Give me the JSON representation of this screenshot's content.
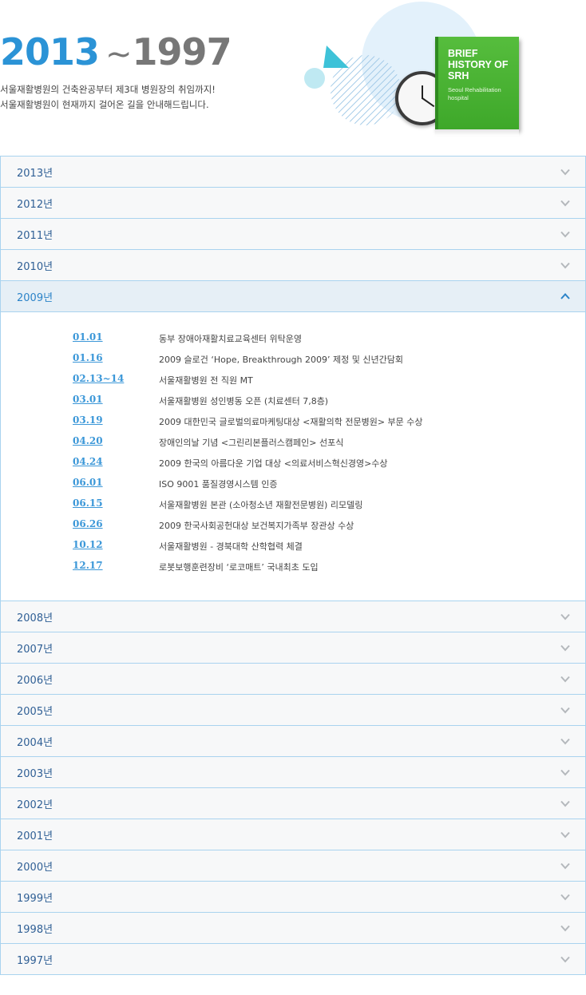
{
  "header": {
    "year_start": "2013",
    "tilde": "~",
    "year_end": "1997",
    "desc_line1": "서울재활병원의 건축완공부터 제3대 병원장의 취임까지!",
    "desc_line2": "서울재활병원이 현재까지 걸어온 길을 안내해드립니다."
  },
  "book": {
    "title": "BRIEF\nHISTORY OF\nSRH",
    "subtitle": "Seoul Rehabilitation\nhospital"
  },
  "years": [
    {
      "label": "2013년",
      "open": false
    },
    {
      "label": "2012년",
      "open": false
    },
    {
      "label": "2011년",
      "open": false
    },
    {
      "label": "2010년",
      "open": false
    },
    {
      "label": "2009년",
      "open": true
    },
    {
      "label": "2008년",
      "open": false
    },
    {
      "label": "2007년",
      "open": false
    },
    {
      "label": "2006년",
      "open": false
    },
    {
      "label": "2005년",
      "open": false
    },
    {
      "label": "2004년",
      "open": false
    },
    {
      "label": "2003년",
      "open": false
    },
    {
      "label": "2002년",
      "open": false
    },
    {
      "label": "2001년",
      "open": false
    },
    {
      "label": "2000년",
      "open": false
    },
    {
      "label": "1999년",
      "open": false
    },
    {
      "label": "1998년",
      "open": false
    },
    {
      "label": "1997년",
      "open": false
    }
  ],
  "events_2009": [
    {
      "date": "01.01",
      "text": "동부 장애아재활치료교육센터 위탁운영"
    },
    {
      "date": "01.16",
      "text": "2009 슬로건 ‘Hope, Breakthrough 2009’ 제정 및 신년간담회"
    },
    {
      "date": "02.13~14",
      "text": "서울재활병원 전 직원 MT"
    },
    {
      "date": "03.01",
      "text": "서울재활병원 성인병동 오픈 (치료센터 7,8층)"
    },
    {
      "date": "03.19",
      "text": "2009 대한민국 글로벌의료마케팅대상 <재활의학 전문병원> 부문 수상"
    },
    {
      "date": "04.20",
      "text": "장애인의날 기념 <그린리본플러스캠페인> 선포식"
    },
    {
      "date": "04.24",
      "text": "2009 한국의 아름다운 기업 대상 <의료서비스혁신경영>수상"
    },
    {
      "date": "06.01",
      "text": "ISO 9001 품질경영시스템 인증"
    },
    {
      "date": "06.15",
      "text": "서울재활병원 본관 (소아청소년 재활전문병원) 리모델링"
    },
    {
      "date": "06.26",
      "text": "2009 한국사회공헌대상 보건복지가족부 장관상 수상"
    },
    {
      "date": "10.12",
      "text": "서울재활병원 - 경북대학 산학협력 체결"
    },
    {
      "date": "12.17",
      "text": "로봇보행훈련장비 ‘로코매트’ 국내최초 도입"
    }
  ],
  "colors": {
    "accent": "#2b93d6",
    "border": "#a9d3ef",
    "chevron": "#b4b8bc",
    "chevron_open": "#2b83c8",
    "book_green": "#4cb535"
  },
  "icons": {
    "collapsed": "chevron-down-icon",
    "expanded": "chevron-up-icon"
  }
}
